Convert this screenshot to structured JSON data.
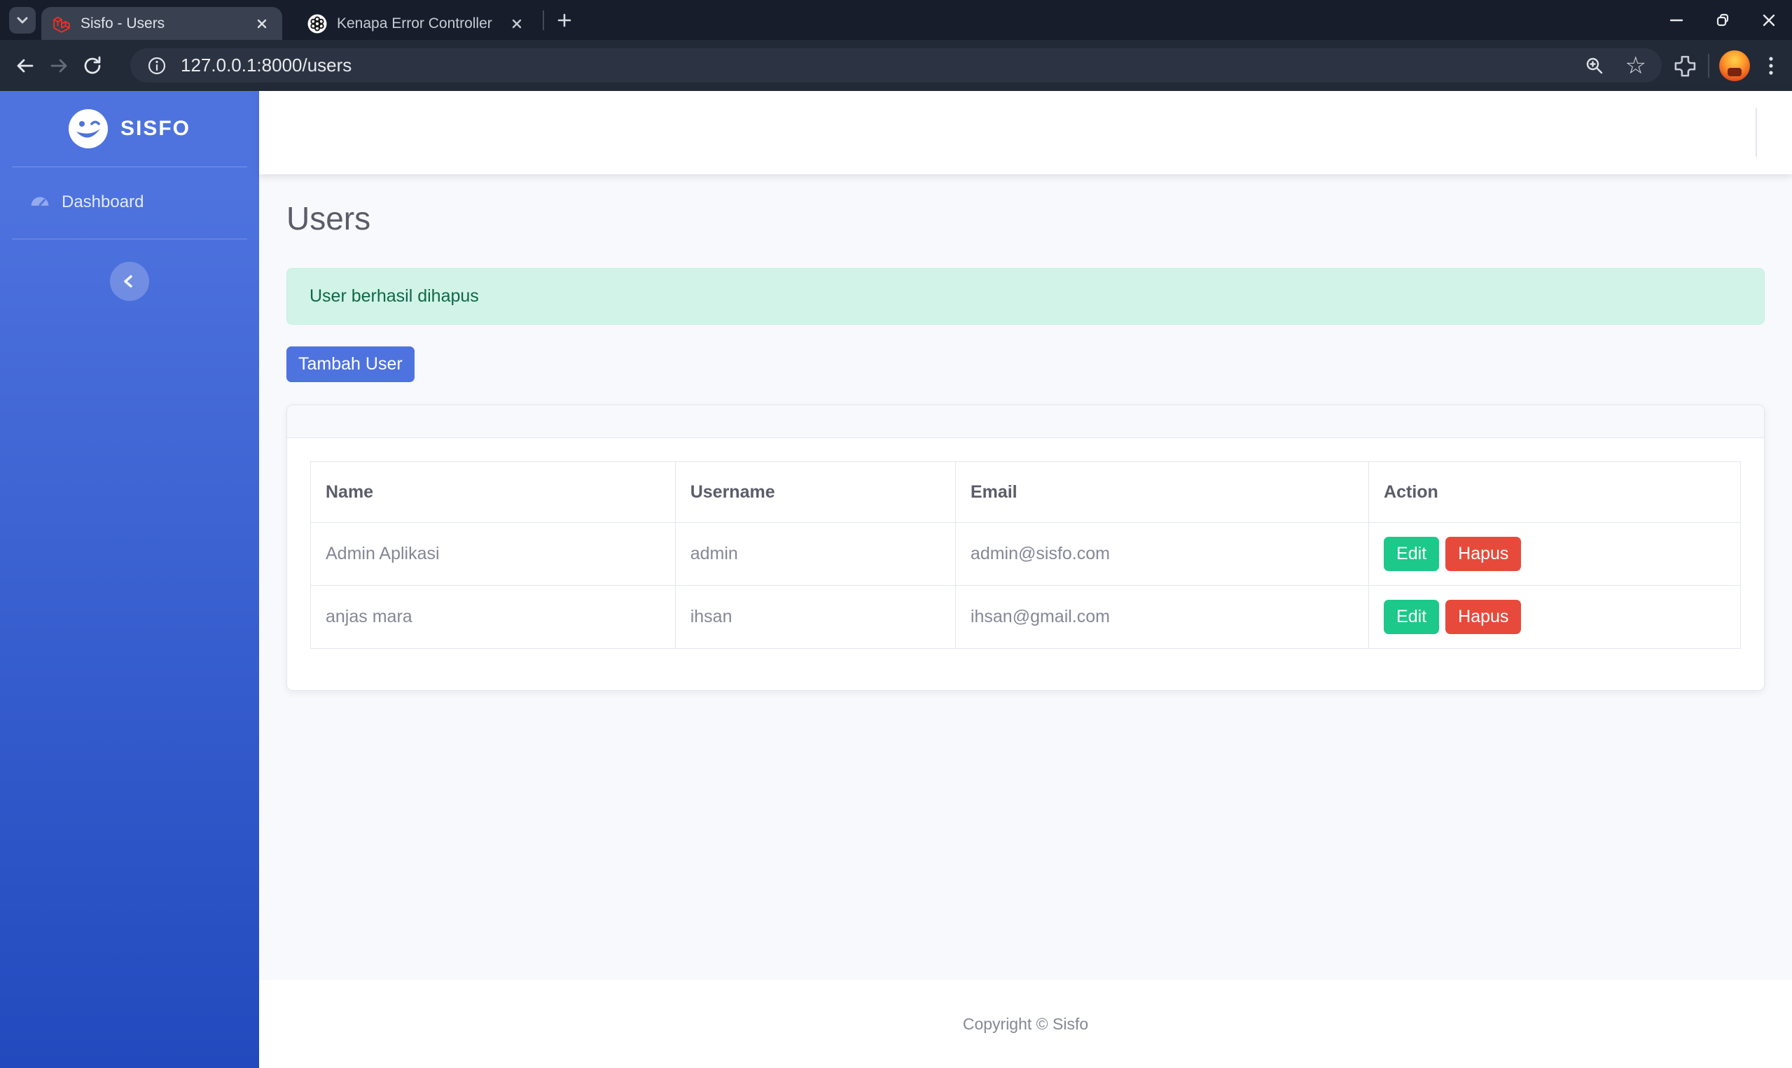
{
  "browser": {
    "tabs": [
      {
        "title": "Sisfo - Users"
      },
      {
        "title": "Kenapa Error Controller"
      }
    ],
    "url": "127.0.0.1:8000/users"
  },
  "sidebar": {
    "brand": "SISFO",
    "items": [
      {
        "label": "Dashboard"
      }
    ]
  },
  "page": {
    "title": "Users",
    "alert_message": "User berhasil dihapus",
    "add_user_button": "Tambah User",
    "table": {
      "headers": [
        "Name",
        "Username",
        "Email",
        "Action"
      ],
      "rows": [
        {
          "name": "Admin Aplikasi",
          "username": "admin",
          "email": "admin@sisfo.com"
        },
        {
          "name": "anjas mara",
          "username": "ihsan",
          "email": "ihsan@gmail.com"
        }
      ]
    },
    "actions": {
      "edit": "Edit",
      "delete": "Hapus"
    },
    "footer": "Copyright © Sisfo"
  },
  "colors": {
    "sidebar_gradient_top": "#4e73df",
    "sidebar_gradient_bottom": "#224abe",
    "primary": "#4e73df",
    "success": "#1cc88a",
    "danger": "#e74a3b",
    "alert_bg": "#d2f4e8",
    "alert_text": "#0f6848",
    "content_bg": "#f8f9fc",
    "heading_text": "#5a5c69",
    "muted_text": "#858796",
    "table_border": "#e3e6f0"
  }
}
